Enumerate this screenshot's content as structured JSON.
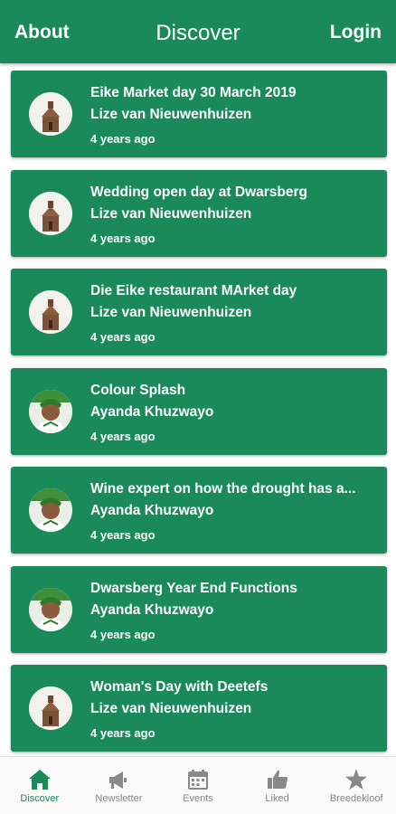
{
  "header": {
    "about_label": "About",
    "title": "Discover",
    "login_label": "Login"
  },
  "posts": [
    {
      "title": "Eike Market day 30 March 2019",
      "author": "Lize van Nieuwenhuizen",
      "time": "4 years ago",
      "avatar": "building-avatar"
    },
    {
      "title": "Wedding open day at Dwarsberg",
      "author": "Lize van Nieuwenhuizen",
      "time": "4 years ago",
      "avatar": "building-avatar"
    },
    {
      "title": "Die Eike restaurant MArket day",
      "author": "Lize van Nieuwenhuizen",
      "time": "4 years ago",
      "avatar": "building-avatar"
    },
    {
      "title": "Colour Splash",
      "author": "Ayanda Khuzwayo",
      "time": "4 years ago",
      "avatar": "person-avatar"
    },
    {
      "title": "Wine expert on how the drought has a...",
      "author": "Ayanda Khuzwayo",
      "time": "4 years ago",
      "avatar": "person-avatar"
    },
    {
      "title": "Dwarsberg Year End Functions",
      "author": "Ayanda Khuzwayo",
      "time": "4 years ago",
      "avatar": "person-avatar"
    },
    {
      "title": "Woman's Day with Deetefs",
      "author": "Lize van Nieuwenhuizen",
      "time": "4 years ago",
      "avatar": "building-avatar"
    }
  ],
  "tabs": [
    {
      "label": "Discover",
      "icon": "home-icon",
      "active": true
    },
    {
      "label": "Newsletter",
      "icon": "megaphone-icon",
      "active": false
    },
    {
      "label": "Events",
      "icon": "calendar-icon",
      "active": false
    },
    {
      "label": "Liked",
      "icon": "thumbs-up-icon",
      "active": false
    },
    {
      "label": "Breedekloof",
      "icon": "star-icon",
      "active": false
    }
  ],
  "colors": {
    "primary": "#1b8a5a",
    "tab_inactive": "#888888",
    "tab_active": "#1b8a5a"
  }
}
